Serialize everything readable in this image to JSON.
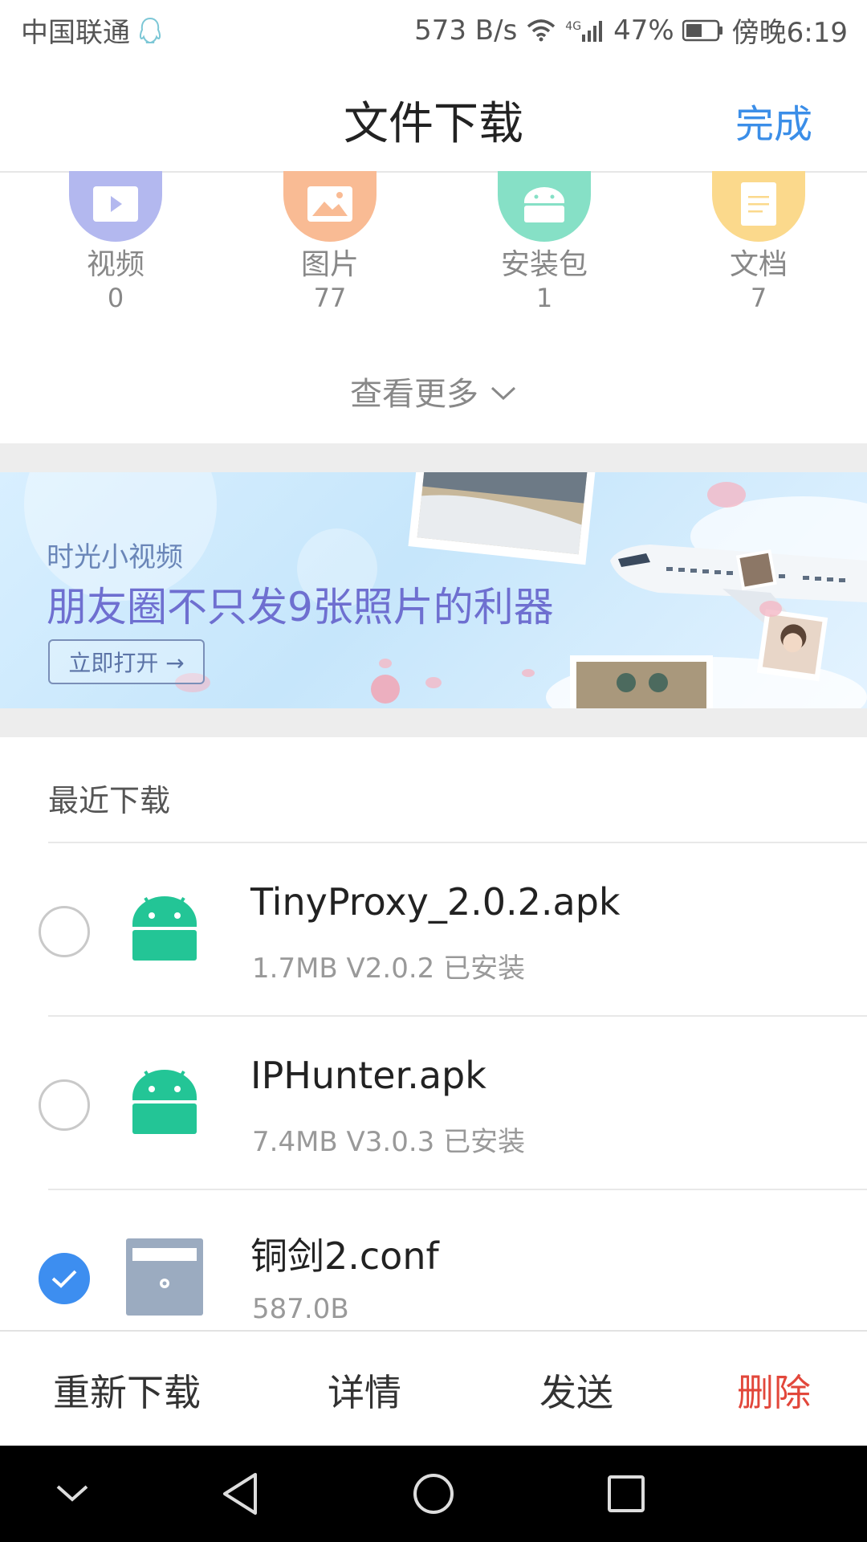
{
  "status_bar": {
    "carrier": "中国联通",
    "net_speed": "573 B/s",
    "network": "4G",
    "battery": "47%",
    "time": "傍晚6:19"
  },
  "header": {
    "title": "文件下载",
    "done_label": "完成"
  },
  "categories": [
    {
      "label": "视频",
      "count": "0",
      "color": "#b3b8ef",
      "icon": "video-icon"
    },
    {
      "label": "图片",
      "count": "77",
      "color": "#f9bb94",
      "icon": "image-icon"
    },
    {
      "label": "安装包",
      "count": "1",
      "color": "#86e0c6",
      "icon": "android-icon"
    },
    {
      "label": "文档",
      "count": "7",
      "color": "#fbd98c",
      "icon": "document-icon"
    }
  ],
  "more_label": "查看更多",
  "banner": {
    "subtitle": "时光小视频",
    "headline": "朋友圈不只发9张照片的利器",
    "button": "立即打开 →"
  },
  "recent": {
    "title": "最近下载",
    "items": [
      {
        "name": "TinyProxy_2.0.2.apk",
        "meta": "1.7MB  V2.0.2 已安装",
        "type": "android-icon",
        "checked": false
      },
      {
        "name": "IPHunter.apk",
        "meta": "7.4MB  V3.0.3 已安装",
        "type": "android-icon",
        "checked": false
      },
      {
        "name": "铜剑2.conf",
        "meta": "587.0B",
        "type": "file-icon",
        "checked": true
      }
    ]
  },
  "actions": {
    "redownload": "重新下载",
    "details": "详情",
    "send": "发送",
    "delete": "删除"
  },
  "colors": {
    "accent": "#3b8ee8",
    "danger": "#e2473b",
    "android_green": "#23c596"
  }
}
